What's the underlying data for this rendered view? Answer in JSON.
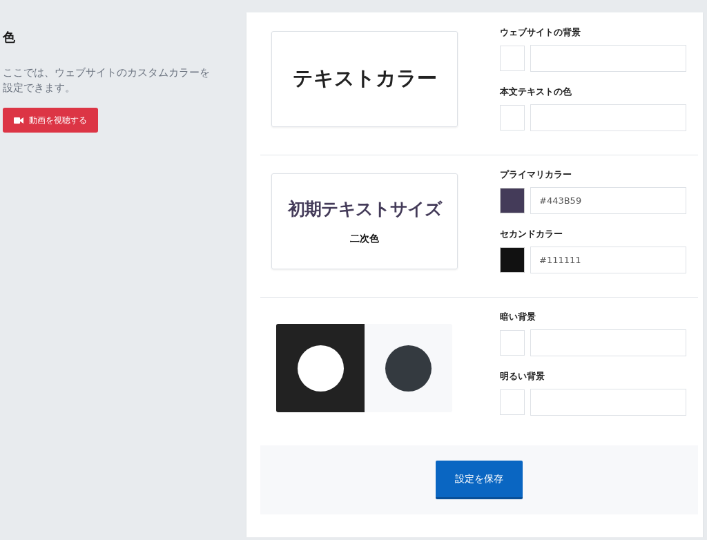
{
  "sidebar": {
    "title": "色",
    "description": "ここでは、ウェブサイトのカスタムカラーを設定できます。",
    "video_button": "動画を視聴する"
  },
  "sections": [
    {
      "kind": "text",
      "preview": {
        "title": "テキストカラー"
      },
      "fields": [
        {
          "label": "ウェブサイトの背景"
        },
        {
          "label": "本文テキストの色"
        }
      ]
    },
    {
      "kind": "typography",
      "preview": {
        "title": "初期テキストサイズ",
        "subtitle": "二次色"
      },
      "fields": [
        {
          "label": "プライマリカラー",
          "value": "#443B59",
          "color": "#443b59"
        },
        {
          "label": "セカンドカラー",
          "value": "#111111",
          "color": "#111111"
        }
      ]
    },
    {
      "kind": "backgrounds",
      "fields": [
        {
          "label": "暗い背景"
        },
        {
          "label": "明るい背景"
        }
      ]
    }
  ],
  "save_button": "設定を保存"
}
